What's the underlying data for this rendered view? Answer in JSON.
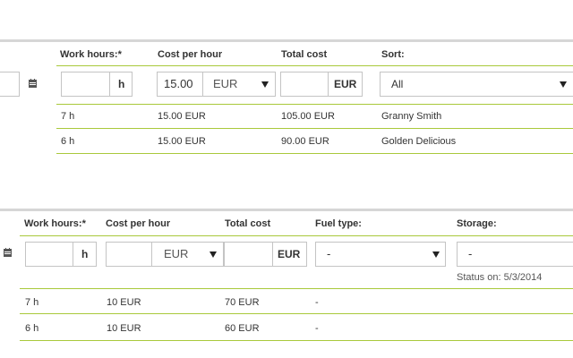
{
  "table1": {
    "headers": {
      "work_hours": "Work hours:*",
      "cost_per_hour": "Cost per hour",
      "total_cost": "Total cost",
      "sort": "Sort:"
    },
    "inputs": {
      "work_hours_value": "",
      "work_hours_unit": "h",
      "cost_value": "15.00",
      "cost_currency": "EUR",
      "total_value": "",
      "total_unit": "EUR",
      "sort_selected": "All"
    },
    "rows": [
      {
        "hours": "7 h",
        "cost": "15.00 EUR",
        "total": "105.00 EUR",
        "sort": "Granny Smith"
      },
      {
        "hours": "6 h",
        "cost": "15.00 EUR",
        "total": "90.00 EUR",
        "sort": "Golden Delicious"
      }
    ]
  },
  "table2": {
    "headers": {
      "work_hours": "Work hours:*",
      "cost_per_hour": "Cost per hour",
      "total_cost": "Total cost",
      "fuel_type": "Fuel type:",
      "storage": "Storage:"
    },
    "inputs": {
      "work_hours_value": "",
      "work_hours_unit": "h",
      "cost_value": "",
      "cost_currency": "EUR",
      "total_value": "",
      "total_unit": "EUR",
      "fuel_selected": "-",
      "storage_selected": "-",
      "status_note": "Status on: 5/3/2014"
    },
    "rows": [
      {
        "hours": "7 h",
        "cost": "10 EUR",
        "total": "70 EUR",
        "fuel": "-"
      },
      {
        "hours": "6 h",
        "cost": "10 EUR",
        "total": "60 EUR",
        "fuel": "-"
      }
    ]
  },
  "icons": {
    "calendar": "calendar-icon",
    "dropdown": "triangle-down-icon"
  },
  "colors": {
    "accent_line": "#a9c93b",
    "top_border": "#d6d6d6",
    "field_border": "#c4c4c4"
  }
}
